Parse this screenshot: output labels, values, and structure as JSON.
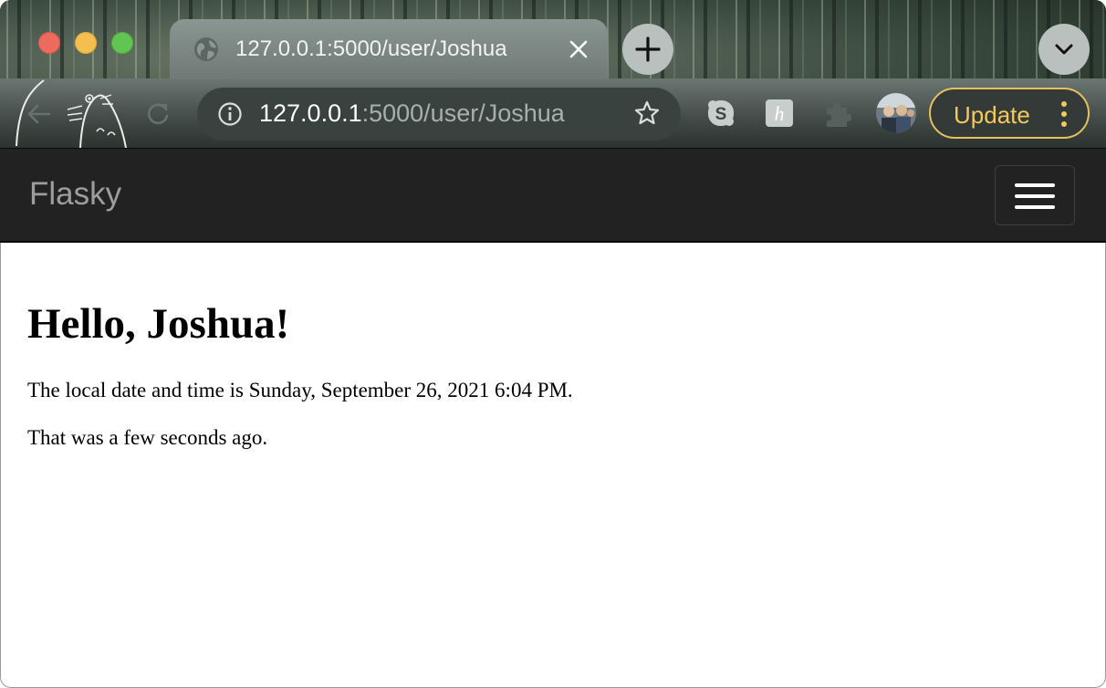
{
  "browser": {
    "tab": {
      "title": "127.0.0.1:5000/user/Joshua"
    },
    "address_bar": {
      "host": "127.0.0.1",
      "path": ":5000/user/Joshua"
    },
    "update_button": {
      "label": "Update"
    },
    "icons": {
      "tab_favicon": "globe-icon",
      "tab_close": "close-icon",
      "new_tab": "plus-icon",
      "tab_search": "chevron-down-icon",
      "back": "back-arrow-icon",
      "reload": "reload-icon",
      "site_info": "info-icon",
      "bookmark": "star-icon",
      "extensions": [
        "skype-icon",
        "honey-icon",
        "puzzle-icon"
      ],
      "profile": "avatar",
      "menu": "three-dots-icon"
    },
    "colors": {
      "update_accent": "#f2c95a",
      "traffic_red": "#ed6a5e",
      "traffic_yellow": "#f5bf4f",
      "traffic_green": "#61c554"
    }
  },
  "page": {
    "navbar": {
      "brand": "Flasky",
      "toggler_icon": "hamburger-icon",
      "background": "#222222"
    },
    "heading": "Hello, Joshua!",
    "local_time_text": "The local date and time is Sunday, September 26, 2021 6:04 PM.",
    "relative_time_text": "That was a few seconds ago."
  }
}
